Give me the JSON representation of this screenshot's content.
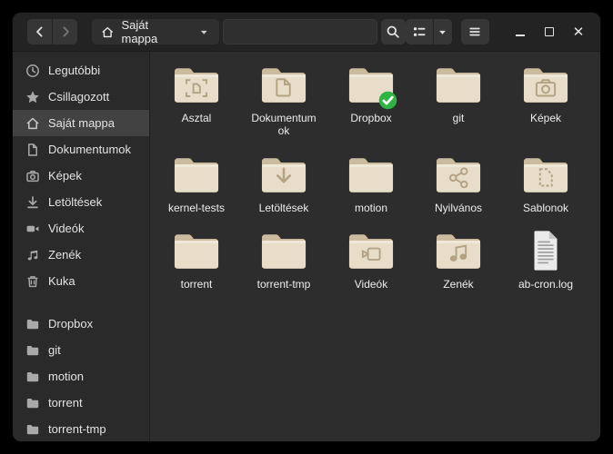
{
  "header": {
    "location": {
      "icon": "home-icon",
      "label": "Saját mappa",
      "dropdown_icon": "caret-down-icon"
    },
    "location_entry_value": "",
    "back_icon": "back-arrow-icon",
    "forward_icon": "forward-arrow-icon",
    "search_icon": "magnifier-icon",
    "view_toggle_icon": "list-view-icon",
    "view_dropdown_icon": "caret-down-icon",
    "menu_icon": "hamburger-icon",
    "window_controls": {
      "minimize": "minimize",
      "maximize": "maximize",
      "close": "close"
    }
  },
  "sidebar": {
    "selected": "Saját mappa",
    "sections": [
      {
        "items": [
          {
            "icon": "clock",
            "label": "Legutóbbi"
          },
          {
            "icon": "star",
            "label": "Csillagozott"
          },
          {
            "icon": "home",
            "label": "Saját mappa"
          },
          {
            "icon": "doc",
            "label": "Dokumentumok"
          },
          {
            "icon": "camera",
            "label": "Képek"
          },
          {
            "icon": "download",
            "label": "Letöltések"
          },
          {
            "icon": "video",
            "label": "Videók"
          },
          {
            "icon": "music",
            "label": "Zenék"
          },
          {
            "icon": "trash",
            "label": "Kuka"
          }
        ]
      },
      {
        "items": [
          {
            "icon": "folder",
            "label": "Dropbox"
          },
          {
            "icon": "folder",
            "label": "git"
          },
          {
            "icon": "folder",
            "label": "motion"
          },
          {
            "icon": "folder",
            "label": "torrent"
          },
          {
            "icon": "folder",
            "label": "torrent-tmp"
          }
        ]
      }
    ]
  },
  "files": {
    "items": [
      {
        "label": "Asztal",
        "type": "folder",
        "emblem": "desktop"
      },
      {
        "label": "Dokumentumok",
        "type": "folder",
        "emblem": "document"
      },
      {
        "label": "Dropbox",
        "type": "folder",
        "emblem": null,
        "badge": "check"
      },
      {
        "label": "git",
        "type": "folder",
        "emblem": null
      },
      {
        "label": "Képek",
        "type": "folder",
        "emblem": "camera"
      },
      {
        "label": "kernel-tests",
        "type": "folder",
        "emblem": null
      },
      {
        "label": "Letöltések",
        "type": "folder",
        "emblem": "download"
      },
      {
        "label": "motion",
        "type": "folder",
        "emblem": null
      },
      {
        "label": "Nyilvános",
        "type": "folder",
        "emblem": "share"
      },
      {
        "label": "Sablonok",
        "type": "folder",
        "emblem": "template"
      },
      {
        "label": "torrent",
        "type": "folder",
        "emblem": null
      },
      {
        "label": "torrent-tmp",
        "type": "folder",
        "emblem": null
      },
      {
        "label": "Videók",
        "type": "folder",
        "emblem": "video"
      },
      {
        "label": "Zenék",
        "type": "folder",
        "emblem": "music"
      },
      {
        "label": "ab-cron.log",
        "type": "file",
        "emblem": null
      }
    ]
  },
  "colors": {
    "headerbar_bg": "#232323",
    "sidebar_bg": "#2a2a2a",
    "main_bg": "#2d2d2d",
    "selection_bg": "#424242",
    "folder_body": "#e7ddc8",
    "folder_tab": "#cbbc9f",
    "emblem_stroke": "#b3a283",
    "badge_green": "#2db442"
  }
}
